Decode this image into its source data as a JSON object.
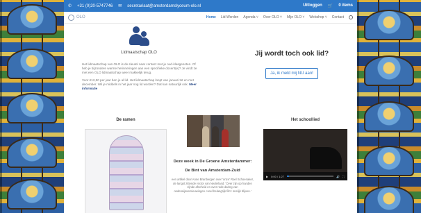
{
  "topbar": {
    "phone": "+31 (0)20-5747746",
    "email": "secretariaat@amsterdamslyceum-olo.nl",
    "login": "Uitloggen",
    "cart": "0 items"
  },
  "nav": {
    "logo_text": "OLO",
    "items": [
      {
        "label": "Home",
        "active": true
      },
      {
        "label": "Lid Worden",
        "active": false
      },
      {
        "label": "Agenda",
        "active": false
      },
      {
        "label": "Over OLO",
        "active": false
      },
      {
        "label": "Mijn OLO",
        "active": false
      },
      {
        "label": "Webshop",
        "active": false
      },
      {
        "label": "Contact",
        "active": false
      }
    ]
  },
  "membership": {
    "title": "Lidmaatschap OLO",
    "para1": "Het lidmaatschap van OLO is de sleutel naar contact met je oud-klasgenoten. Of heb je bijzondere warme herinneringen aan een specifieke docent(e)? Je vindt ze met een OLO lidmaatschap weer makkelijk terug.",
    "para2": "Voor €12,50 per jaar ben je al lid. Het lidmaatschap loopt van januari tot en met december. Wil je middels in het jaar nog lid worden? Dat kan natuurlijk ook.",
    "more": "Meer informatie"
  },
  "join": {
    "title": "Jij wordt toch ook lid?",
    "button": "Ja, ik meld mij NU aan!"
  },
  "columns": {
    "ramen": "De ramen",
    "groene_title": "Deze week in De Groene Amsterdammer:",
    "groene_subtitle": "De Bint van Amsterdam-Zuid",
    "groene_text": "een artikel door Anne Branbergen over 'onze' Roel Schoenaker, de langst zittende rector van Nederland. 'Over zijn op handen zijnde afscheid en over rode daring van onderwijsvernieuwingen. Heel belangrijk film: snelijk blijven.'",
    "schoollied": "Het schoollied"
  },
  "video": {
    "time": "0:00 / 1:27"
  }
}
